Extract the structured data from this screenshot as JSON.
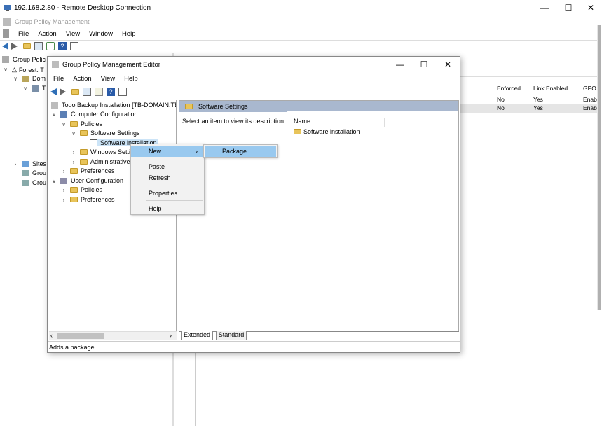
{
  "rdp": {
    "title": "192.168.2.80 - Remote Desktop Connection"
  },
  "gpm": {
    "title": "Group Policy Management",
    "menu": [
      "File",
      "Action",
      "View",
      "Window",
      "Help"
    ],
    "tree": [
      {
        "label": "Group Polic",
        "expanded": null
      },
      {
        "label": "Forest: T",
        "expanded": true
      },
      {
        "label": "Dom",
        "expanded": true
      },
      {
        "label": "T",
        "expanded": true
      },
      {
        "label": "Sites",
        "expanded": false
      },
      {
        "label": "Grou",
        "expanded": null
      },
      {
        "label": "Grou",
        "expanded": null
      }
    ],
    "columns": [
      "Enforced",
      "Link Enabled",
      "GPO"
    ],
    "rows": [
      {
        "enforced": "No",
        "link_enabled": "Yes",
        "gpo": "Enab"
      },
      {
        "enforced": "No",
        "link_enabled": "Yes",
        "gpo": "Enab"
      }
    ]
  },
  "editor": {
    "title": "Group Policy Management Editor",
    "menu": [
      "File",
      "Action",
      "View",
      "Help"
    ],
    "tree": [
      {
        "label": "Todo Backup Installation [TB-DOMAIN.TB"
      },
      {
        "label": "Computer Configuration"
      },
      {
        "label": "Policies"
      },
      {
        "label": "Software Settings"
      },
      {
        "label": "Software installation"
      },
      {
        "label": "Windows Setti"
      },
      {
        "label": "Administrative"
      },
      {
        "label": "Preferences"
      },
      {
        "label": "User Configuration"
      },
      {
        "label": "Policies"
      },
      {
        "label": "Preferences"
      }
    ],
    "right_header": "Software Settings",
    "description": "Select an item to view its description.",
    "list_header": "Name",
    "list_items": [
      "Software installation"
    ],
    "tabs": [
      "Extended",
      "Standard"
    ],
    "status": "Adds a package."
  },
  "context_menu": {
    "items": [
      "New",
      "Paste",
      "Refresh",
      "Properties",
      "Help"
    ],
    "submenu": [
      "Package..."
    ]
  },
  "colors": {
    "selection": "#cce4f7",
    "highlight": "#99c9ef",
    "header_band": "#a9b8cf"
  }
}
